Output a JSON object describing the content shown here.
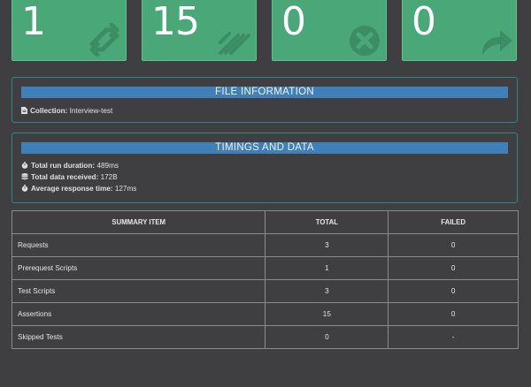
{
  "cards": [
    {
      "value": "1",
      "icon": "refresh-icon"
    },
    {
      "value": "15",
      "icon": "list-check-icon"
    },
    {
      "value": "0",
      "icon": "times-circle-icon"
    },
    {
      "value": "0",
      "icon": "share-arrow-icon"
    }
  ],
  "file_info": {
    "title": "FILE INFORMATION",
    "collection_label": "Collection:",
    "collection_value": "Interview-test"
  },
  "timings": {
    "title": "TIMINGS AND DATA",
    "rows": [
      {
        "label": "Total run duration:",
        "value": "489ms",
        "icon": "stopwatch-icon"
      },
      {
        "label": "Total data received:",
        "value": "172B",
        "icon": "database-icon"
      },
      {
        "label": "Average response time:",
        "value": "127ms",
        "icon": "stopwatch-icon"
      }
    ]
  },
  "summary": {
    "headers": [
      "SUMMARY ITEM",
      "TOTAL",
      "FAILED"
    ],
    "rows": [
      {
        "item": "Requests",
        "total": "3",
        "failed": "0"
      },
      {
        "item": "Prerequest Scripts",
        "total": "1",
        "failed": "0"
      },
      {
        "item": "Test Scripts",
        "total": "3",
        "failed": "0"
      },
      {
        "item": "Assertions",
        "total": "15",
        "failed": "0"
      },
      {
        "item": "Skipped Tests",
        "total": "0",
        "failed": "-"
      }
    ]
  },
  "colors": {
    "card_bg": "#4aa878",
    "panel_border": "#2f8a86",
    "title_bar": "#3f80b8",
    "page_bg": "#3f3e40"
  }
}
